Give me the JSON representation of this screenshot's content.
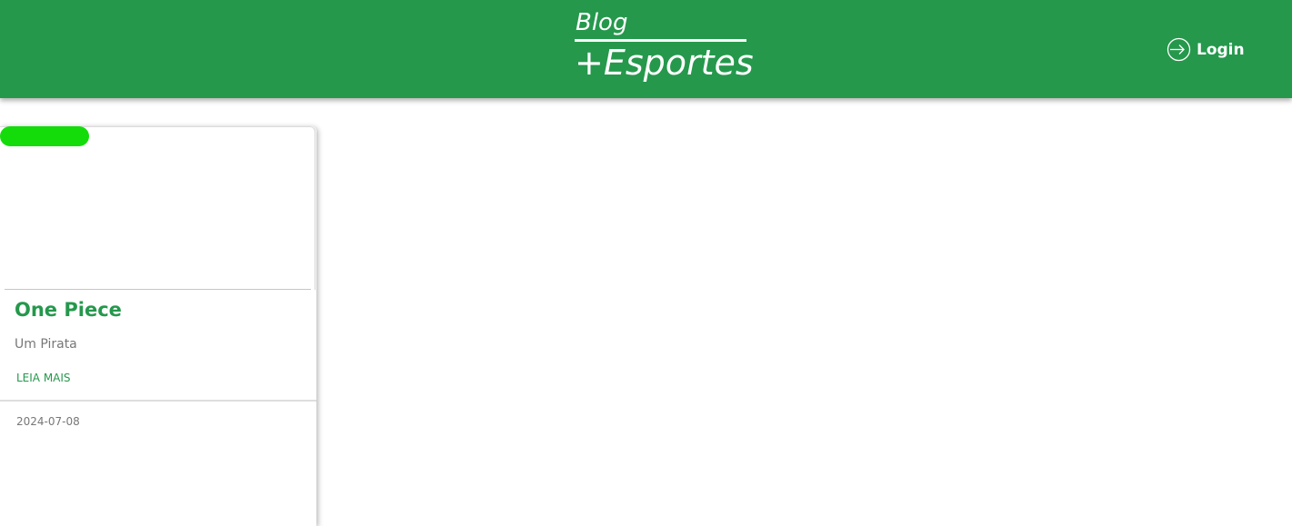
{
  "header": {
    "logo_top": "Blog",
    "logo_bottom": "+Esportes",
    "login_label": "Login",
    "login_icon": "login-arrow-icon",
    "background_color": "#25984c"
  },
  "posts": [
    {
      "title": "One Piece",
      "subtitle": "Um Pirata",
      "link_label": "LEIA MAIS",
      "date": "2024-07-08",
      "badge_color": "#14dc0b"
    }
  ]
}
